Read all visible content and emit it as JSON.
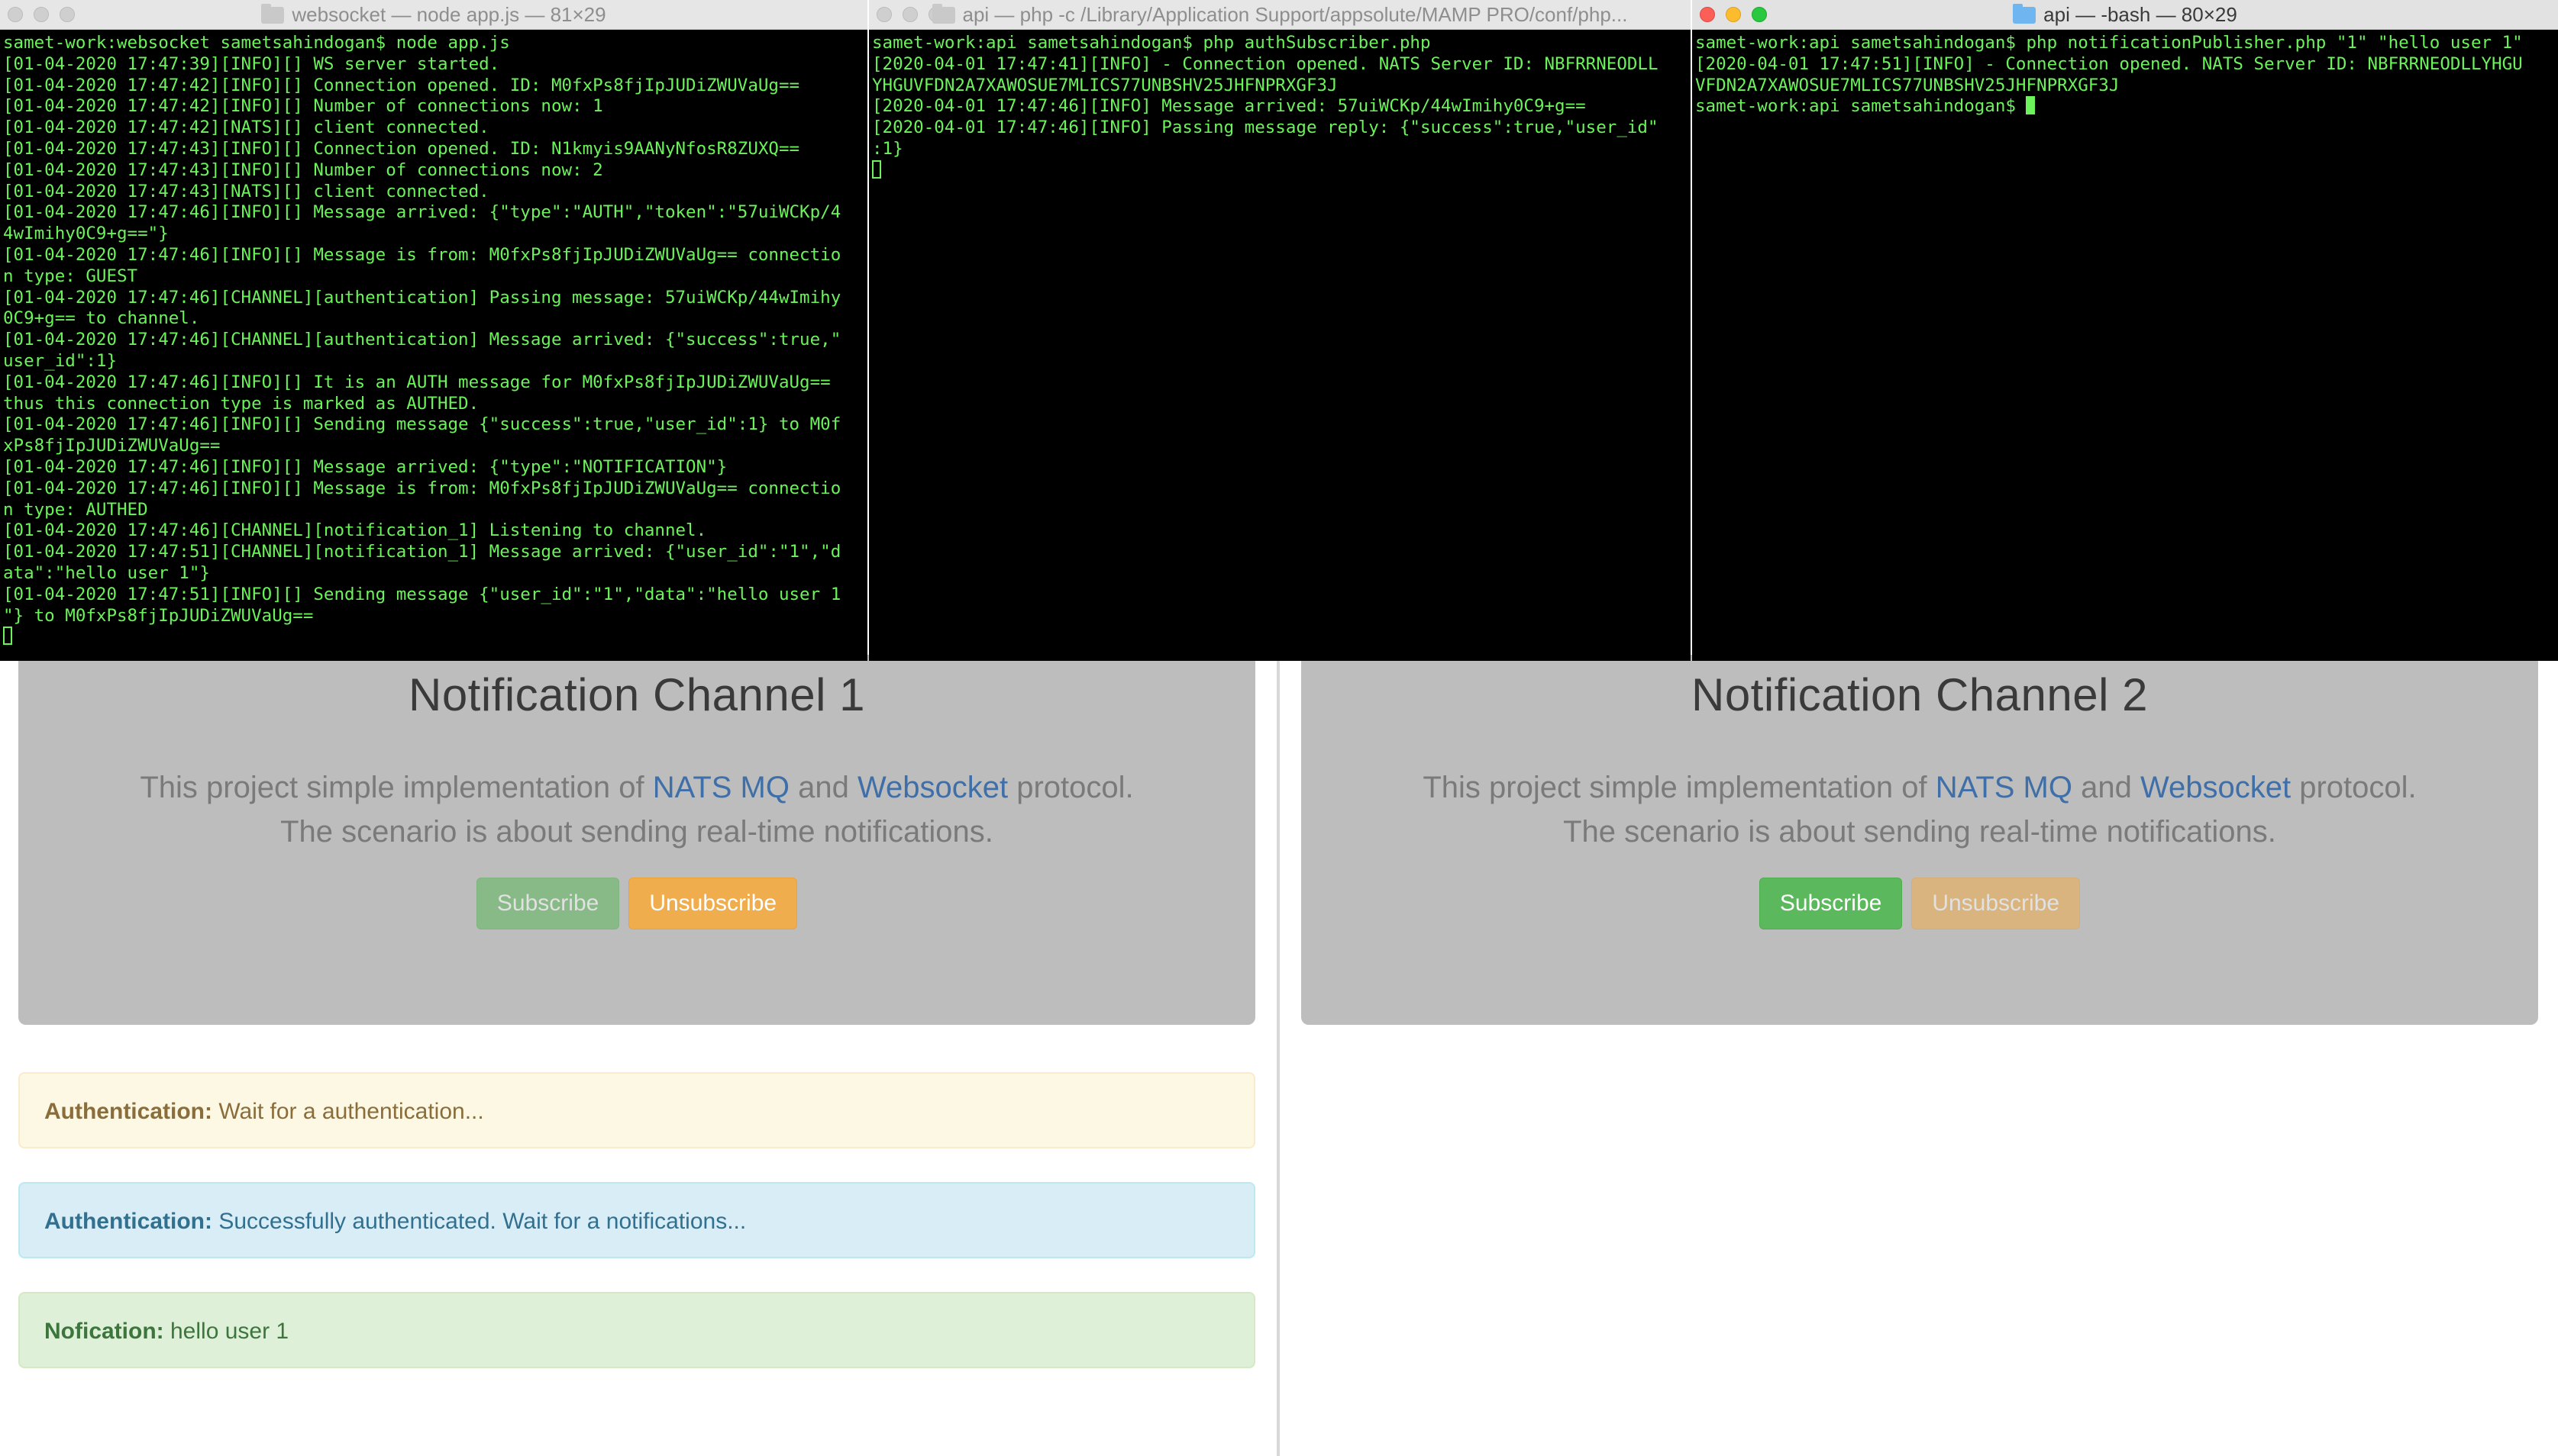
{
  "browser": {
    "left": {
      "title": "Notification Channel 1",
      "lead_prefix": "This project simple implementation of ",
      "link_nats": "NATS MQ",
      "lead_and": " and ",
      "link_ws": "Websocket",
      "lead_suffix": " protocol.",
      "lead_line2": "The scenario is about sending real-time notifications.",
      "subscribe_label": "Subscribe",
      "unsubscribe_label": "Unsubscribe",
      "alerts": [
        {
          "label": "Authentication:",
          "text": " Wait for a authentication..."
        },
        {
          "label": "Authentication:",
          "text": " Successfully authenticated. Wait for a notifications..."
        },
        {
          "label": "Nofication:",
          "text": " hello user 1"
        }
      ]
    },
    "right": {
      "title": "Notification Channel 2",
      "lead_prefix": "This project simple implementation of ",
      "link_nats": "NATS MQ",
      "lead_and": " and ",
      "link_ws": "Websocket",
      "lead_suffix": " protocol.",
      "lead_line2": "The scenario is about sending real-time notifications.",
      "subscribe_label": "Subscribe",
      "unsubscribe_label": "Unsubscribe"
    }
  },
  "terminals": [
    {
      "title": "websocket — node app.js — 81×29",
      "lines": [
        "samet-work:websocket sametsahindogan$ node app.js",
        "[01-04-2020 17:47:39][INFO][] WS server started.",
        "[01-04-2020 17:47:42][INFO][] Connection opened. ID: M0fxPs8fjIpJUDiZWUVaUg==",
        "[01-04-2020 17:47:42][INFO][] Number of connections now: 1",
        "[01-04-2020 17:47:42][NATS][] client connected.",
        "[01-04-2020 17:47:43][INFO][] Connection opened. ID: N1kmyis9AANyNfosR8ZUXQ==",
        "[01-04-2020 17:47:43][INFO][] Number of connections now: 2",
        "[01-04-2020 17:47:43][NATS][] client connected.",
        "[01-04-2020 17:47:46][INFO][] Message arrived: {\"type\":\"AUTH\",\"token\":\"57uiWCKp/4",
        "4wImihy0C9+g==\"}",
        "[01-04-2020 17:47:46][INFO][] Message is from: M0fxPs8fjIpJUDiZWUVaUg== connectio",
        "n type: GUEST",
        "[01-04-2020 17:47:46][CHANNEL][authentication] Passing message: 57uiWCKp/44wImihy",
        "0C9+g== to channel.",
        "[01-04-2020 17:47:46][CHANNEL][authentication] Message arrived: {\"success\":true,\"",
        "user_id\":1}",
        "[01-04-2020 17:47:46][INFO][] It is an AUTH message for M0fxPs8fjIpJUDiZWUVaUg==",
        "thus this connection type is marked as AUTHED.",
        "[01-04-2020 17:47:46][INFO][] Sending message {\"success\":true,\"user_id\":1} to M0f",
        "xPs8fjIpJUDiZWUVaUg==",
        "[01-04-2020 17:47:46][INFO][] Message arrived: {\"type\":\"NOTIFICATION\"}",
        "[01-04-2020 17:47:46][INFO][] Message is from: M0fxPs8fjIpJUDiZWUVaUg== connectio",
        "n type: AUTHED",
        "[01-04-2020 17:47:46][CHANNEL][notification_1] Listening to channel.",
        "[01-04-2020 17:47:51][CHANNEL][notification_1] Message arrived: {\"user_id\":\"1\",\"d",
        "ata\":\"hello user 1\"}",
        "[01-04-2020 17:47:51][INFO][] Sending message {\"user_id\":\"1\",\"data\":\"hello user 1",
        "\"} to M0fxPs8fjIpJUDiZWUVaUg=="
      ]
    },
    {
      "title": "api — php -c /Library/Application Support/appsolute/MAMP PRO/conf/php...",
      "lines": [
        "samet-work:api sametsahindogan$ php authSubscriber.php",
        "[2020-04-01 17:47:41][INFO] - Connection opened. NATS Server ID: NBFRRNEODLL",
        "YHGUVFDN2A7XAWOSUE7MLICS77UNBSHV25JHFNPRXGF3J",
        "[2020-04-01 17:47:46][INFO] Message arrived: 57uiWCKp/44wImihy0C9+g==",
        "[2020-04-01 17:47:46][INFO] Passing message reply: {\"success\":true,\"user_id\"",
        ":1}"
      ]
    },
    {
      "title": "api — -bash — 80×29",
      "lines": [
        "samet-work:api sametsahindogan$ php notificationPublisher.php \"1\" \"hello user 1\"",
        "[2020-04-01 17:47:51][INFO] - Connection opened. NATS Server ID: NBFRRNEODLLYHGU",
        "VFDN2A7XAWOSUE7MLICS77UNBSHV25JHFNPRXGF3J"
      ],
      "prompt": "samet-work:api sametsahindogan$ "
    }
  ]
}
